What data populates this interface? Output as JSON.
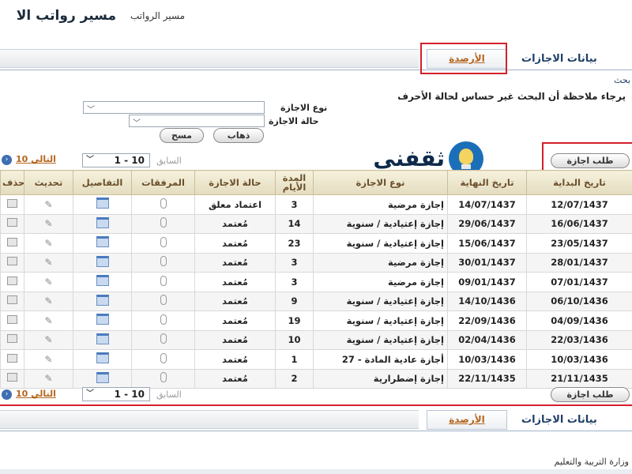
{
  "header": {
    "title": "مسير رواتب الا",
    "subtitle": "مسير الرواتب"
  },
  "tabs": {
    "leave_data": "بيانات الاجازات",
    "balances": "الأرصدة"
  },
  "search": {
    "link": "بحث",
    "note": "يرجاء ملاحظة أن البحث غير حساس لحالة الأحرف",
    "leave_type_label": "نوع الاجازة",
    "leave_status_label": "حالة الاجازة",
    "go_button": "ذهاب",
    "clear_button": "مسح"
  },
  "nav": {
    "request_leave": "طلب اجازة",
    "prev": "السابق",
    "range": "1 - 10",
    "next": "10 التالي"
  },
  "logo": {
    "text": "ثقفني"
  },
  "table": {
    "headers": {
      "start_date": "تاريخ البداية",
      "end_date": "تاريخ النهاية",
      "leave_type": "نوع الاجازة",
      "duration": "المدة الأيام",
      "status": "حالة الاجازة",
      "attachments": "المرفقات",
      "details": "التفاصيل",
      "update": "تحديث",
      "delete": "حذف"
    },
    "rows": [
      {
        "start": "12/07/1437",
        "end": "14/07/1437",
        "type": "إجازة مرضية",
        "days": "3",
        "status": "اعتماد معلق"
      },
      {
        "start": "16/06/1437",
        "end": "29/06/1437",
        "type": "إجازة إعتيادية / سنوية",
        "days": "14",
        "status": "مُعتمد"
      },
      {
        "start": "23/05/1437",
        "end": "15/06/1437",
        "type": "إجازة إعتيادية / سنوية",
        "days": "23",
        "status": "مُعتمد"
      },
      {
        "start": "28/01/1437",
        "end": "30/01/1437",
        "type": "إجازة مرضية",
        "days": "3",
        "status": "مُعتمد"
      },
      {
        "start": "07/01/1437",
        "end": "09/01/1437",
        "type": "إجازة مرضية",
        "days": "3",
        "status": "مُعتمد"
      },
      {
        "start": "06/10/1436",
        "end": "14/10/1436",
        "type": "إجازة إعتيادية / سنوية",
        "days": "9",
        "status": "مُعتمد"
      },
      {
        "start": "04/09/1436",
        "end": "22/09/1436",
        "type": "إجازة إعتيادية / سنوية",
        "days": "19",
        "status": "مُعتمد"
      },
      {
        "start": "22/03/1436",
        "end": "02/04/1436",
        "type": "إجازة إعتيادية / سنوية",
        "days": "10",
        "status": "مُعتمد"
      },
      {
        "start": "10/03/1436",
        "end": "10/03/1436",
        "type": "أجازة عادية المادة - 27",
        "days": "1",
        "status": "مُعتمد"
      },
      {
        "start": "21/11/1435",
        "end": "22/11/1435",
        "type": "إجازة إضطرارية",
        "days": "2",
        "status": "مُعتمد"
      }
    ]
  },
  "footer": {
    "ministry": "وزارة التربية والتعليم"
  },
  "colors": {
    "accent_red": "#d3202a",
    "header_bg": "#e3dcc0",
    "link_orange": "#b5651d",
    "tab_blue": "#1f3f66"
  }
}
